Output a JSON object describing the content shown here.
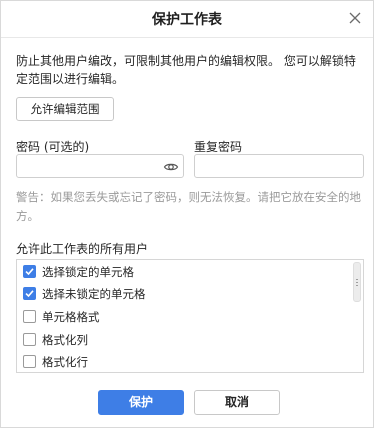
{
  "dialog": {
    "title": "保护工作表",
    "description": "防止其他用户编改，可限制其他用户的编辑权限。 您可以解锁特定范围以进行编辑。",
    "allow_range_button": "允许编辑范围",
    "password_label": "密码 (可选的)",
    "password_value": "",
    "confirm_label": "重复密码",
    "confirm_value": "",
    "warning": "警告：如果您丢失或忘记了密码，则无法恢复。请把它放在安全的地方。",
    "permissions_label": "允许此工作表的所有用户",
    "permissions": [
      {
        "label": "选择锁定的单元格",
        "checked": true
      },
      {
        "label": "选择未锁定的单元格",
        "checked": true
      },
      {
        "label": "单元格格式",
        "checked": false
      },
      {
        "label": "格式化列",
        "checked": false
      },
      {
        "label": "格式化行",
        "checked": false
      }
    ],
    "protect_button": "保护",
    "cancel_button": "取消",
    "accent_color": "#3e7ee6",
    "icons": {
      "close": "close-icon",
      "eye": "eye-icon",
      "check": "check-icon"
    }
  }
}
